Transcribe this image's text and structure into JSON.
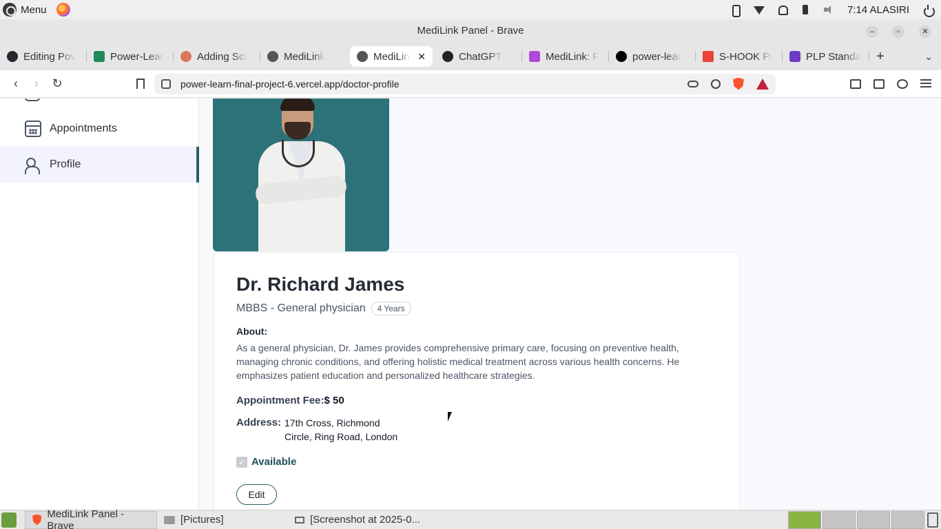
{
  "system_bar": {
    "menu_label": "Menu",
    "clock": "7:14 ALASIRI"
  },
  "window": {
    "title": "MediLink Panel - Brave"
  },
  "tabs": [
    {
      "label": "Editing Pov",
      "icon": "github-icon"
    },
    {
      "label": "Power-Lear",
      "icon": "power-learn-icon"
    },
    {
      "label": "Adding Scr",
      "icon": "claude-icon"
    },
    {
      "label": "MediLink",
      "icon": "globe-icon"
    },
    {
      "label": "MediLin",
      "icon": "globe-icon",
      "active": true
    },
    {
      "label": "ChatGPT",
      "icon": "chatgpt-icon"
    },
    {
      "label": "MediLink: F",
      "icon": "app-icon"
    },
    {
      "label": "power-lear",
      "icon": "vercel-icon"
    },
    {
      "label": "S-HOOK Pi",
      "icon": "gmail-icon"
    },
    {
      "label": "PLP Standa",
      "icon": "plp-icon"
    }
  ],
  "address_bar": {
    "url": "power-learn-final-project-6.vercel.app/doctor-profile"
  },
  "sidebar": {
    "items": [
      {
        "label": "Appointments",
        "icon": "calendar-icon"
      },
      {
        "label": "Profile",
        "icon": "people-icon",
        "active": true
      }
    ]
  },
  "profile": {
    "name": "Dr. Richard James",
    "speciality": "MBBS - General physician",
    "experience": "4 Years",
    "about_label": "About:",
    "about_text": "As a general physician, Dr. James provides comprehensive primary care, focusing on preventive health, managing chronic conditions, and offering holistic medical treatment across various health concerns. He emphasizes patient education and personalized healthcare strategies.",
    "fee_label": "Appointment Fee:",
    "fee_value": "$ 50",
    "address_label": "Address:",
    "address_line1": "17th Cross, Richmond",
    "address_line2": "Circle, Ring Road, London",
    "available_label": "Available",
    "available": true,
    "edit_label": "Edit"
  },
  "taskbar": {
    "items": [
      {
        "label": "MediLink Panel - Brave",
        "active": true
      },
      {
        "label": "[Pictures]"
      },
      {
        "label": "[Screenshot at 2025-0..."
      }
    ]
  },
  "colors": {
    "accent": "#2f5d68",
    "photo_bg": "#2e7279",
    "active_sidebar_bg": "#f2f3ff"
  }
}
